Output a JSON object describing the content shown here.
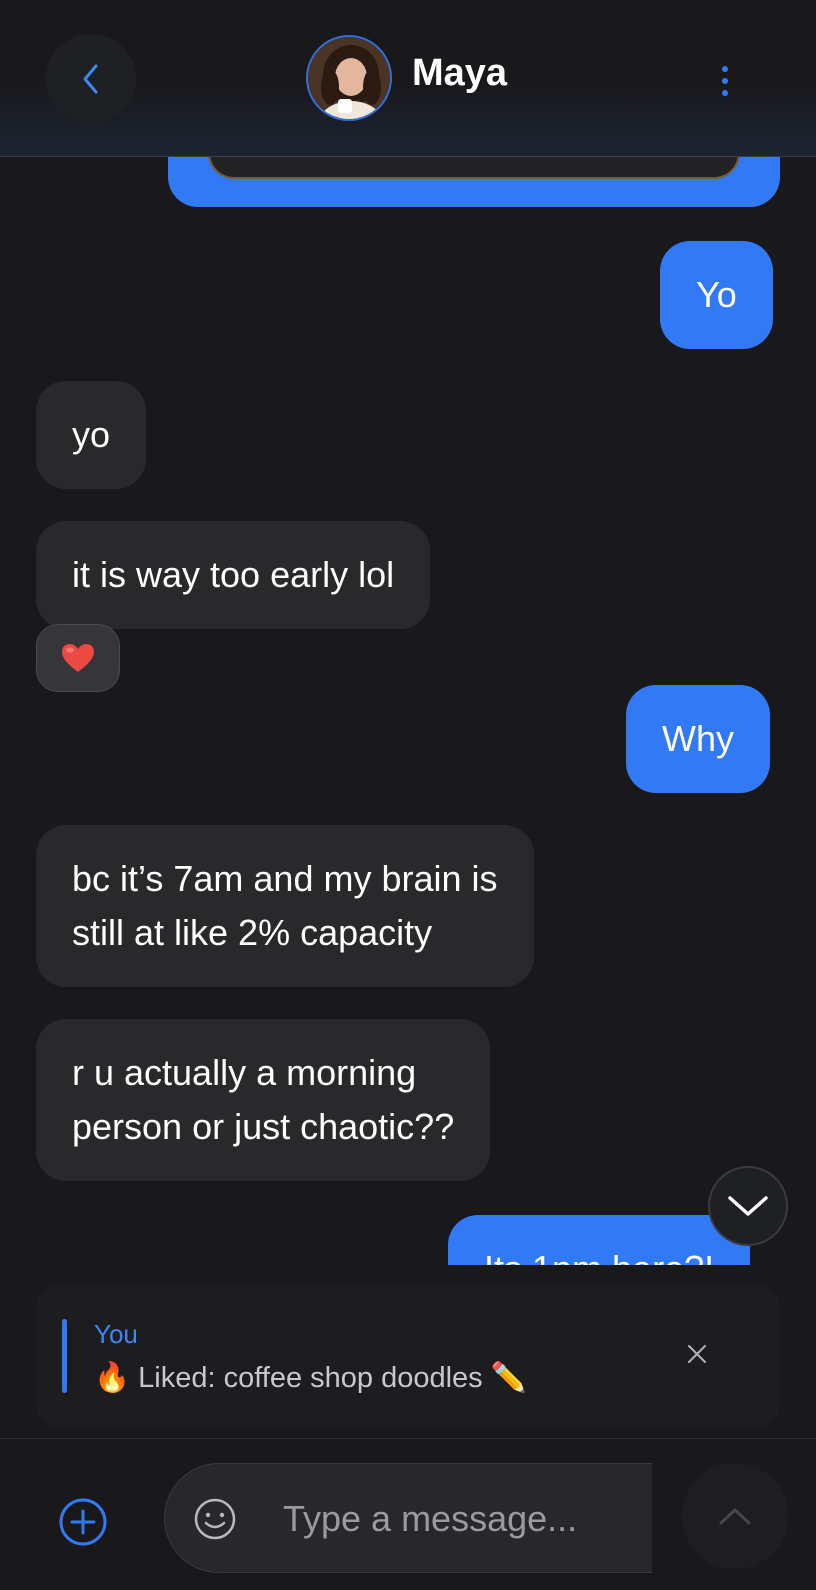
{
  "header": {
    "contact_name": "Maya",
    "back_icon": "chevron-left-icon",
    "more_icon": "more-vertical-icon"
  },
  "messages": [
    {
      "side": "out",
      "text": "Yo"
    },
    {
      "side": "in",
      "text": "yo"
    },
    {
      "side": "in",
      "text": "it is way too early lol",
      "reaction": "❤️"
    },
    {
      "side": "out",
      "text": "Why"
    },
    {
      "side": "in",
      "lines": [
        "bc it’s 7am and my brain is",
        "still at like 2% capacity"
      ]
    },
    {
      "side": "in",
      "lines": [
        "r u actually a morning",
        "person or just chaotic??"
      ]
    },
    {
      "side": "out",
      "text": "Its 1pm here?!"
    }
  ],
  "reply": {
    "author": "You",
    "emoji": "🔥",
    "text": "Liked: coffee shop doodles",
    "trailing_emoji": "✏️"
  },
  "composer": {
    "placeholder": "Type a message..."
  },
  "colors": {
    "accent": "#3179f5",
    "background": "#19191c",
    "incoming_bubble": "#29292c"
  }
}
